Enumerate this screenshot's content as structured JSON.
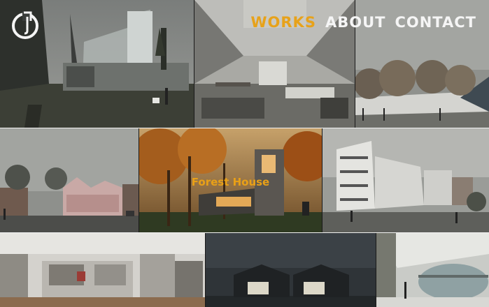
{
  "nav": {
    "items": [
      {
        "label": "WORKS",
        "active": true
      },
      {
        "label": "ABOUT",
        "active": false
      },
      {
        "label": "CONTACT",
        "active": false
      }
    ],
    "active_color": "#e7a21a",
    "text_color": "#f5f5f5"
  },
  "gallery": {
    "hovered_caption": "Forest House"
  }
}
